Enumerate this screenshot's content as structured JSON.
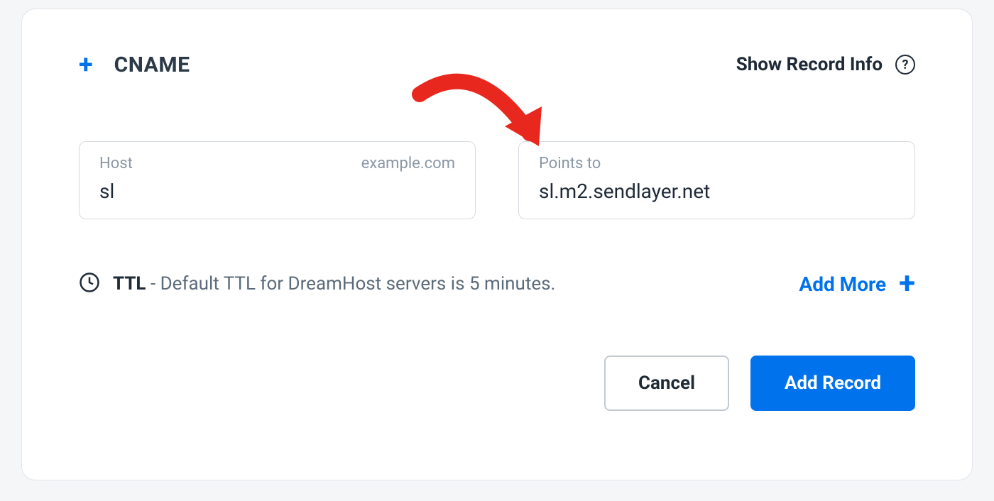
{
  "header": {
    "record_type": "CNAME",
    "info_label": "Show Record Info"
  },
  "fields": {
    "host": {
      "label": "Host",
      "suffix": "example.com",
      "value": "sl"
    },
    "points_to": {
      "label": "Points to",
      "value": "sl.m2.sendlayer.net"
    }
  },
  "ttl": {
    "bold_label": "TTL",
    "description": " - Default TTL for DreamHost servers is 5 minutes."
  },
  "add_more_label": "Add More",
  "buttons": {
    "cancel": "Cancel",
    "add_record": "Add Record"
  }
}
